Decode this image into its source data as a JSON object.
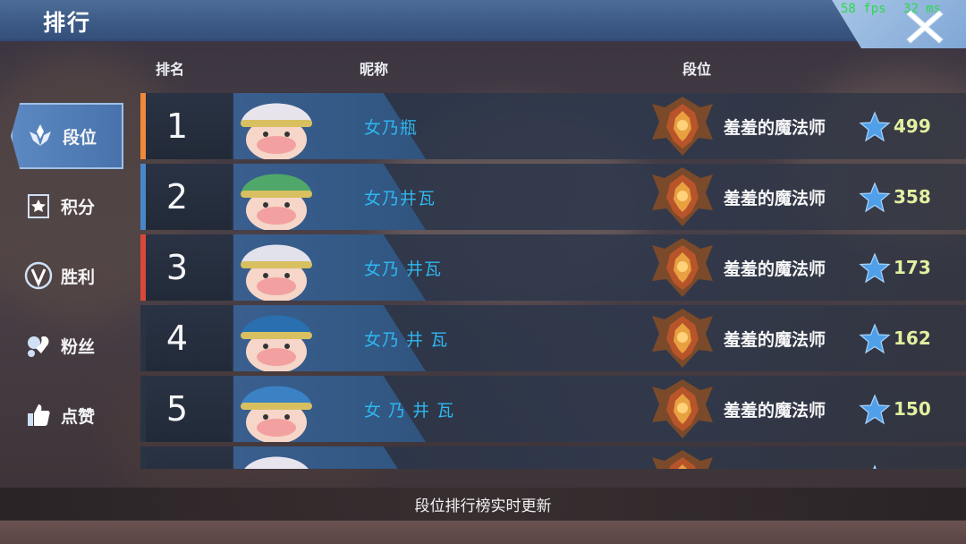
{
  "header": {
    "title": "排行",
    "fps": "58 fps",
    "ms": "32 ms",
    "close_icon": "close-icon"
  },
  "columns": {
    "rank": "排名",
    "nickname": "昵称",
    "tier": "段位"
  },
  "sidebar": {
    "items": [
      {
        "label": "段位",
        "icon": "tier-icon",
        "active": true
      },
      {
        "label": "积分",
        "icon": "points-icon",
        "active": false
      },
      {
        "label": "胜利",
        "icon": "victory-icon",
        "active": false
      },
      {
        "label": "粉丝",
        "icon": "fans-icon",
        "active": false
      },
      {
        "label": "点赞",
        "icon": "thumbs-up-icon",
        "active": false
      }
    ]
  },
  "rows": [
    {
      "rank": "1",
      "nickname": "女乃瓶",
      "tier": "羞羞的魔法师",
      "score": "499",
      "strip_color": "#f08a3a",
      "avatar_hat": "#e8e4ee"
    },
    {
      "rank": "2",
      "nickname": "女乃井瓦",
      "tier": "羞羞的魔法师",
      "score": "358",
      "strip_color": "#4a86c9",
      "avatar_hat": "#4fa86a"
    },
    {
      "rank": "3",
      "nickname": "女乃 井瓦",
      "tier": "羞羞的魔法师",
      "score": "173",
      "strip_color": "#d9483b",
      "avatar_hat": "#e2e2ec"
    },
    {
      "rank": "4",
      "nickname": "女乃 井 瓦",
      "tier": "羞羞的魔法师",
      "score": "162",
      "strip_color": "#2a3344",
      "avatar_hat": "#2a6fb0"
    },
    {
      "rank": "5",
      "nickname": "女 乃 井 瓦",
      "tier": "羞羞的魔法师",
      "score": "150",
      "strip_color": "#2a3344",
      "avatar_hat": "#3b82c4"
    },
    {
      "rank": "",
      "nickname": "",
      "tier": "",
      "score": "",
      "strip_color": "#2a3344",
      "avatar_hat": "#e8e4ee"
    }
  ],
  "footer": {
    "text": "段位排行榜实时更新"
  },
  "colors": {
    "nickname": "#2fb7f0",
    "score": "#e2f0a0",
    "header": "#3c5985"
  }
}
